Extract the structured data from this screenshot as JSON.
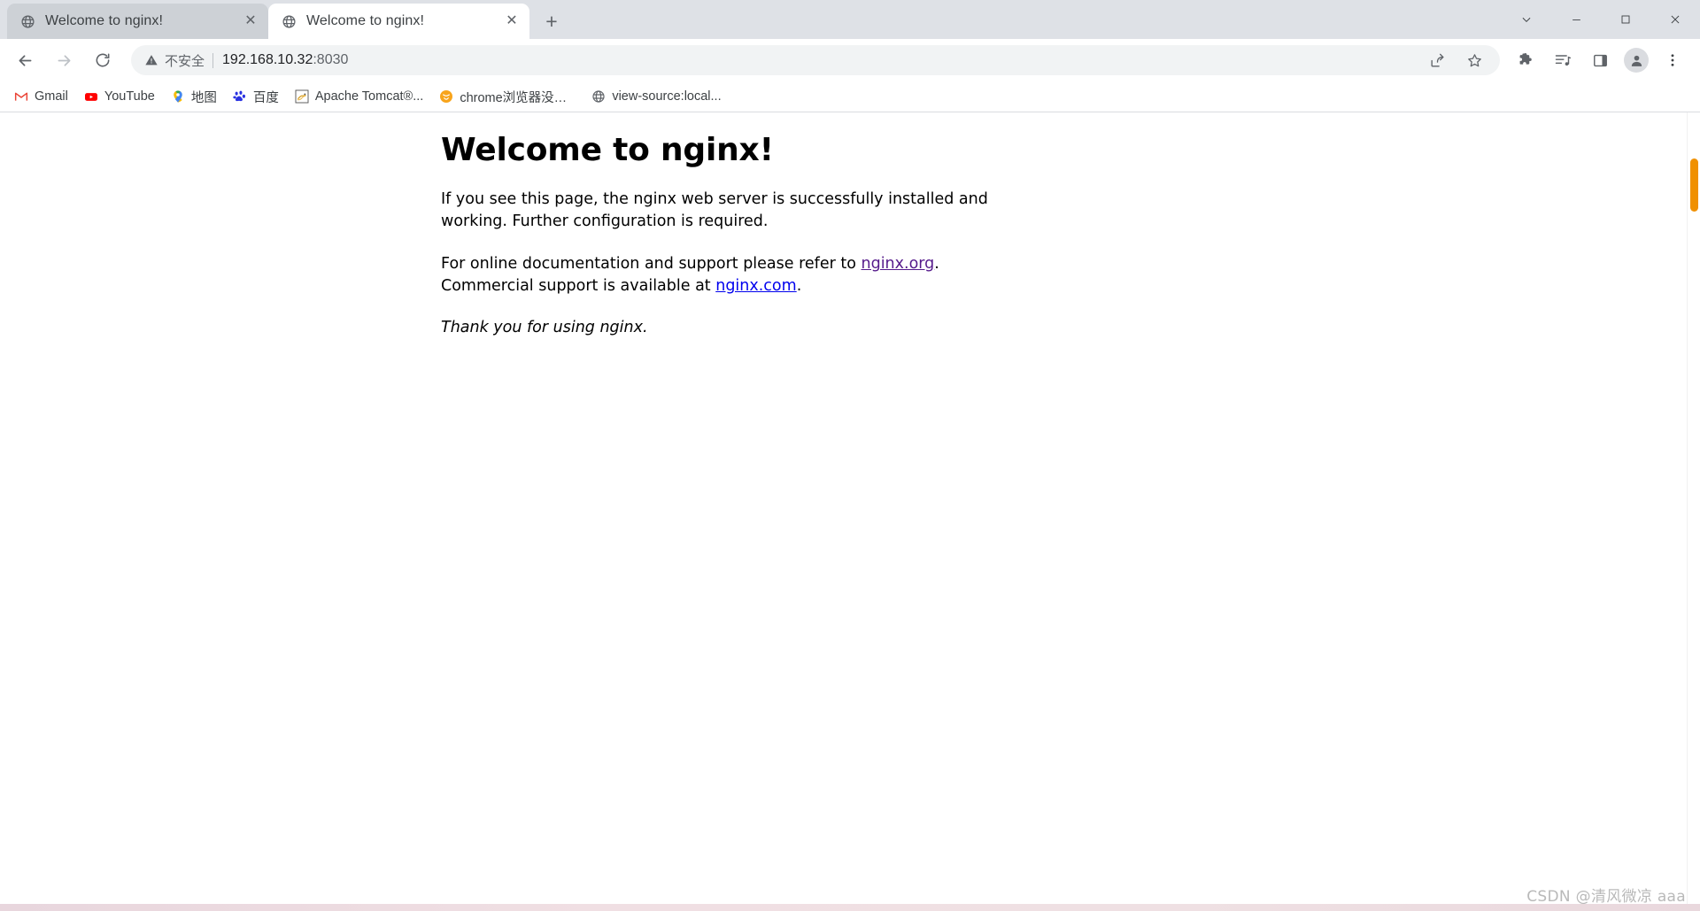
{
  "window": {
    "controls": [
      {
        "name": "minimize-all-chevron",
        "glyph": "⌄"
      },
      {
        "name": "minimize",
        "glyph": "—"
      },
      {
        "name": "maximize",
        "glyph": "▢"
      },
      {
        "name": "close",
        "glyph": "✕"
      }
    ]
  },
  "tabs": [
    {
      "title": "Welcome to nginx!",
      "icon": "globe-icon",
      "active": false,
      "close_glyph": "✕"
    },
    {
      "title": "Welcome to nginx!",
      "icon": "globe-icon",
      "active": true,
      "close_glyph": "✕"
    }
  ],
  "newtab": {
    "label": "+",
    "tooltip": "New tab"
  },
  "toolbar": {
    "back": "←",
    "forward": "→",
    "reload": "⟳",
    "security_label": "不安全",
    "url_host": "192.168.10.32",
    "url_port": ":8030",
    "icons": [
      {
        "name": "share-icon"
      },
      {
        "name": "bookmark-star-icon"
      },
      {
        "name": "extensions-puzzle-icon"
      },
      {
        "name": "media-playlist-icon"
      },
      {
        "name": "side-panel-icon"
      }
    ],
    "profile": {
      "name": "profile-avatar"
    },
    "menu_glyph": "⋮"
  },
  "bookmarks": [
    {
      "label": "Gmail",
      "icon": "gmail-icon"
    },
    {
      "label": "YouTube",
      "icon": "youtube-icon"
    },
    {
      "label": "地图",
      "icon": "google-maps-pin-icon"
    },
    {
      "label": "百度",
      "icon": "baidu-paw-icon"
    },
    {
      "label": "Apache Tomcat®...",
      "icon": "tomcat-icon"
    },
    {
      "label": "chrome浏览器没声...",
      "icon": "orange-circle-icon"
    },
    {
      "label": "view-source:local...",
      "icon": "globe-icon"
    }
  ],
  "page": {
    "heading": "Welcome to nginx!",
    "paragraph1": "If you see this page, the nginx web server is successfully installed and working. Further configuration is required.",
    "paragraph2_prefix": "For online documentation and support please refer to ",
    "link_org": "nginx.org",
    "paragraph2_mid": ".",
    "paragraph2_line2_prefix": "Commercial support is available at ",
    "link_com": "nginx.com",
    "paragraph2_suffix": ".",
    "thanks": "Thank you for using nginx."
  },
  "scrollbar": {
    "position": "right"
  },
  "watermark": "CSDN @清风微凉 aaa",
  "colors": {
    "tabstrip_bg": "#dee1e6",
    "inactive_tab": "#cdd1d6",
    "omnibox_bg": "#f1f3f4",
    "link_visited": "#551a8b",
    "link_unvisited": "#0000ee",
    "scroll_thumb_accent": "#f09000"
  }
}
